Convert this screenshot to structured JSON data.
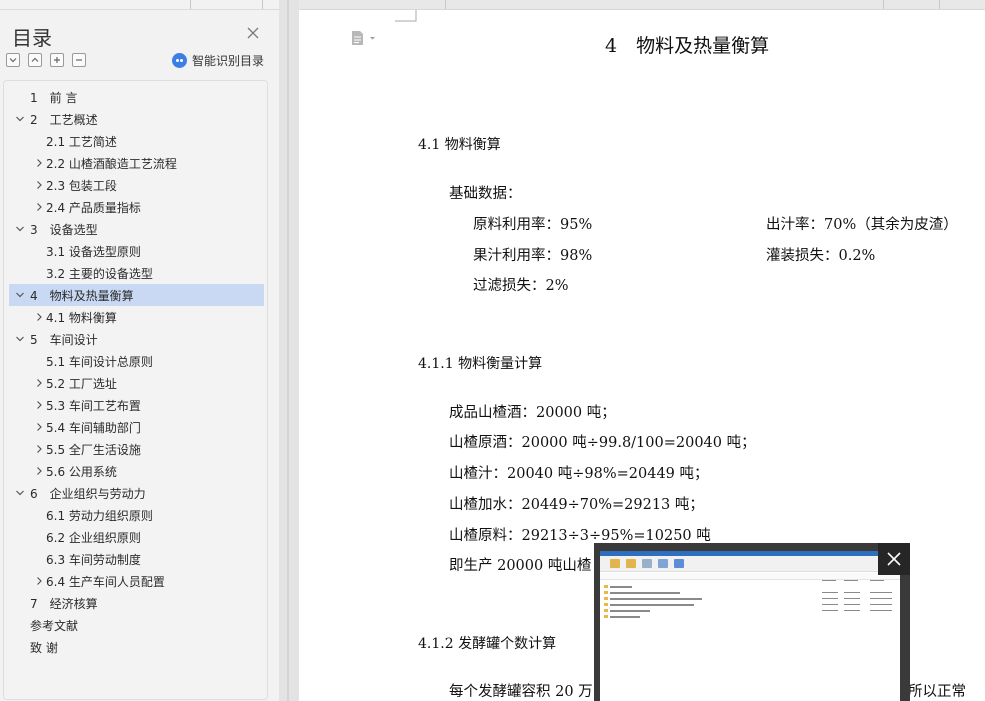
{
  "sidebar": {
    "title": "目录",
    "ai_button_label": "智能识别目录",
    "toc_items": [
      {
        "label": "1　前 言",
        "expandable": false,
        "expanded": false,
        "active": false
      },
      {
        "label": "2　工艺概述",
        "expandable": true,
        "expanded": true,
        "active": false
      },
      {
        "label": "2.1 工艺简述",
        "expandable": false,
        "expanded": false,
        "active": false
      },
      {
        "label": "2.2 山楂酒酿造工艺流程",
        "expandable": true,
        "expanded": false,
        "active": false
      },
      {
        "label": "2.3 包装工段",
        "expandable": true,
        "expanded": false,
        "active": false
      },
      {
        "label": "2.4 产品质量指标",
        "expandable": true,
        "expanded": false,
        "active": false
      },
      {
        "label": "3　设备选型",
        "expandable": true,
        "expanded": true,
        "active": false
      },
      {
        "label": "3.1 设备选型原则",
        "expandable": false,
        "expanded": false,
        "active": false
      },
      {
        "label": "3.2 主要的设备选型",
        "expandable": false,
        "expanded": false,
        "active": false
      },
      {
        "label": "4　物料及热量衡算",
        "expandable": true,
        "expanded": true,
        "active": true
      },
      {
        "label": "4.1 物料衡算",
        "expandable": true,
        "expanded": false,
        "active": false
      },
      {
        "label": "5　车间设计",
        "expandable": true,
        "expanded": true,
        "active": false
      },
      {
        "label": "5.1 车间设计总原则",
        "expandable": false,
        "expanded": false,
        "active": false
      },
      {
        "label": "5.2 工厂选址",
        "expandable": true,
        "expanded": false,
        "active": false
      },
      {
        "label": "5.3 车间工艺布置",
        "expandable": true,
        "expanded": false,
        "active": false
      },
      {
        "label": "5.4 车间辅助部门",
        "expandable": true,
        "expanded": false,
        "active": false
      },
      {
        "label": "5.5 全厂生活设施",
        "expandable": true,
        "expanded": false,
        "active": false
      },
      {
        "label": "5.6 公用系统",
        "expandable": true,
        "expanded": false,
        "active": false
      },
      {
        "label": "6　企业组织与劳动力",
        "expandable": true,
        "expanded": true,
        "active": false
      },
      {
        "label": "6.1 劳动力组织原则",
        "expandable": false,
        "expanded": false,
        "active": false
      },
      {
        "label": "6.2 企业组织原则",
        "expandable": false,
        "expanded": false,
        "active": false
      },
      {
        "label": "6.3 车间劳动制度",
        "expandable": false,
        "expanded": false,
        "active": false
      },
      {
        "label": "6.4 生产车间人员配置",
        "expandable": true,
        "expanded": false,
        "active": false
      },
      {
        "label": "7　经济核算",
        "expandable": false,
        "expanded": false,
        "active": false
      },
      {
        "label": "参考文献",
        "expandable": false,
        "expanded": false,
        "active": false
      },
      {
        "label": "致 谢",
        "expandable": false,
        "expanded": false,
        "active": false
      }
    ]
  },
  "document": {
    "chapter_title": "4　物料及热量衡算",
    "section_4_1": "4.1 物料衡算",
    "basic_data_label": "基础数据：",
    "raw_utilization": "原料利用率：95%",
    "juice_yield": "出汁率：70%（其余为皮渣）",
    "juice_utilization": "果汁利用率：98%",
    "filling_loss": "灌装损失：0.2%",
    "filter_loss": "过滤损失：2%",
    "section_4_1_1": "4.1.1 物料衡量计算",
    "calc_lines": [
      "成品山楂酒：20000 吨；",
      "山楂原酒：20000 吨÷99.8/100=20040 吨；",
      "山楂汁：20040 吨÷98%=20449 吨；",
      "山楂加水：20449÷70%=29213 吨；",
      "山楂原料：29213÷3÷95%=10250 吨",
      "即生产 20000 吨山楂"
    ],
    "section_4_1_2": "4.1.2 发酵罐个数计算",
    "last_line_left": "每个发酵罐容积 20 万",
    "last_line_right": "所以正常"
  },
  "colors": {
    "toc_active_bg": "#c9d9f4",
    "ai_icon": "#3b7ee8"
  }
}
